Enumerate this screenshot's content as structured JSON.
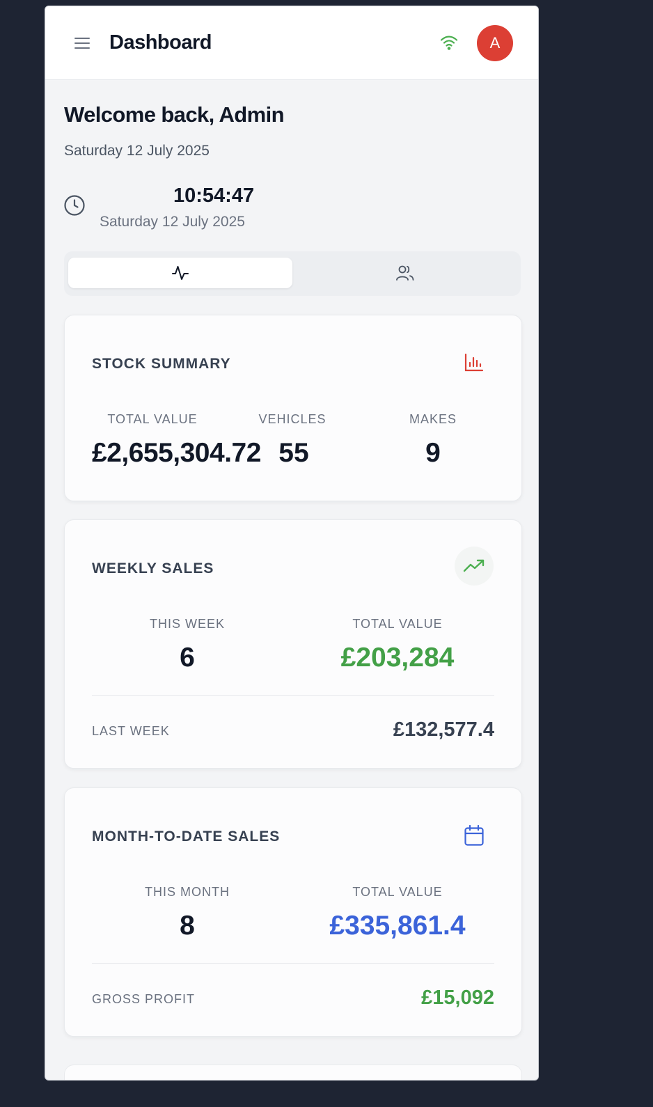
{
  "header": {
    "title": "Dashboard",
    "avatar_initial": "A",
    "menu_icon": "hamburger-icon",
    "status_icon": "wifi-icon",
    "status_color": "#4caf50"
  },
  "welcome": {
    "greeting": "Welcome back, Admin",
    "date": "Saturday 12 July 2025"
  },
  "clock": {
    "time": "10:54:47",
    "date": "Saturday 12 July 2025",
    "icon": "clock-icon"
  },
  "tabs": [
    {
      "icon": "activity-icon",
      "active": true
    },
    {
      "icon": "users-icon",
      "active": false
    }
  ],
  "stock_summary": {
    "title": "STOCK SUMMARY",
    "icon": "bar-chart-icon",
    "icon_color": "#dc3f34",
    "stats": [
      {
        "label": "TOTAL VALUE",
        "value": "£2,655,304.72"
      },
      {
        "label": "VEHICLES",
        "value": "55"
      },
      {
        "label": "MAKES",
        "value": "9"
      }
    ]
  },
  "weekly_sales": {
    "title": "WEEKLY SALES",
    "icon": "trending-up-icon",
    "icon_color": "#4caf50",
    "stats": [
      {
        "label": "THIS WEEK",
        "value": "6"
      },
      {
        "label": "TOTAL VALUE",
        "value": "£203,284"
      }
    ],
    "footer": {
      "label": "LAST WEEK",
      "value": "£132,577.4"
    }
  },
  "mtd_sales": {
    "title": "MONTH-TO-DATE SALES",
    "icon": "calendar-icon",
    "icon_color": "#3b63d9",
    "stats": [
      {
        "label": "THIS MONTH",
        "value": "8"
      },
      {
        "label": "TOTAL VALUE",
        "value": "£335,861.4"
      }
    ],
    "footer": {
      "label": "GROSS PROFIT",
      "value": "£15,092"
    }
  },
  "colors": {
    "green": "#43a047",
    "blue": "#3b63d9",
    "red": "#dc3f34",
    "background": "#1e2433"
  }
}
